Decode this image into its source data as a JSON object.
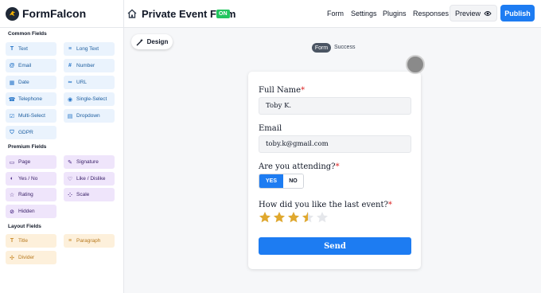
{
  "app": {
    "name": "FormFalcon"
  },
  "header": {
    "form_title": "Private Event Form",
    "status_badge": "ON",
    "nav": [
      "Form",
      "Settings",
      "Plugins",
      "Responses"
    ],
    "preview_label": "Preview",
    "publish_label": "Publish"
  },
  "sidebar": {
    "sections": [
      {
        "title": "Common Fields",
        "items": [
          {
            "label": "Text",
            "icon": "text-icon"
          },
          {
            "label": "Long Text",
            "icon": "long-text-icon"
          },
          {
            "label": "Email",
            "icon": "at-icon"
          },
          {
            "label": "Number",
            "icon": "number-icon"
          },
          {
            "label": "Date",
            "icon": "calendar-icon"
          },
          {
            "label": "URL",
            "icon": "link-icon"
          },
          {
            "label": "Telephone",
            "icon": "phone-icon"
          },
          {
            "label": "Single-Select",
            "icon": "radio-icon"
          },
          {
            "label": "Multi-Select",
            "icon": "checkbox-icon"
          },
          {
            "label": "Dropdown",
            "icon": "dropdown-icon"
          },
          {
            "label": "GDPR",
            "icon": "shield-icon"
          }
        ]
      },
      {
        "title": "Premium Fields",
        "items": [
          {
            "label": "Page",
            "icon": "page-icon"
          },
          {
            "label": "Signature",
            "icon": "signature-icon"
          },
          {
            "label": "Yes / No",
            "icon": "toggle-icon"
          },
          {
            "label": "Like / Dislike",
            "icon": "thumbs-icon"
          },
          {
            "label": "Rating",
            "icon": "star-icon"
          },
          {
            "label": "Scale",
            "icon": "scale-icon"
          },
          {
            "label": "Hidden",
            "icon": "eye-off-icon"
          }
        ]
      },
      {
        "title": "Layout Fields",
        "items": [
          {
            "label": "Title",
            "icon": "title-icon"
          },
          {
            "label": "Paragraph",
            "icon": "paragraph-icon"
          },
          {
            "label": "Divider",
            "icon": "divider-icon"
          }
        ]
      }
    ]
  },
  "canvas": {
    "design_label": "Design",
    "tabs": {
      "form": "Form",
      "success": "Success"
    }
  },
  "form": {
    "full_name": {
      "label": "Full Name",
      "required_mark": "*",
      "value": "Toby K."
    },
    "email": {
      "label": "Email",
      "value": "toby.k@gmail.com"
    },
    "attending": {
      "label": "Are you attending?",
      "required_mark": "*",
      "options": [
        "YES",
        "NO"
      ],
      "selected": "YES"
    },
    "rating": {
      "label": "How did you like the last event?",
      "required_mark": "*",
      "value": 3.5,
      "max": 5
    },
    "submit_label": "Send"
  },
  "colors": {
    "accent": "#1d7cf2",
    "star_filled": "#e0a82e",
    "star_empty": "#e5e7eb",
    "on_badge": "#22c55e"
  }
}
